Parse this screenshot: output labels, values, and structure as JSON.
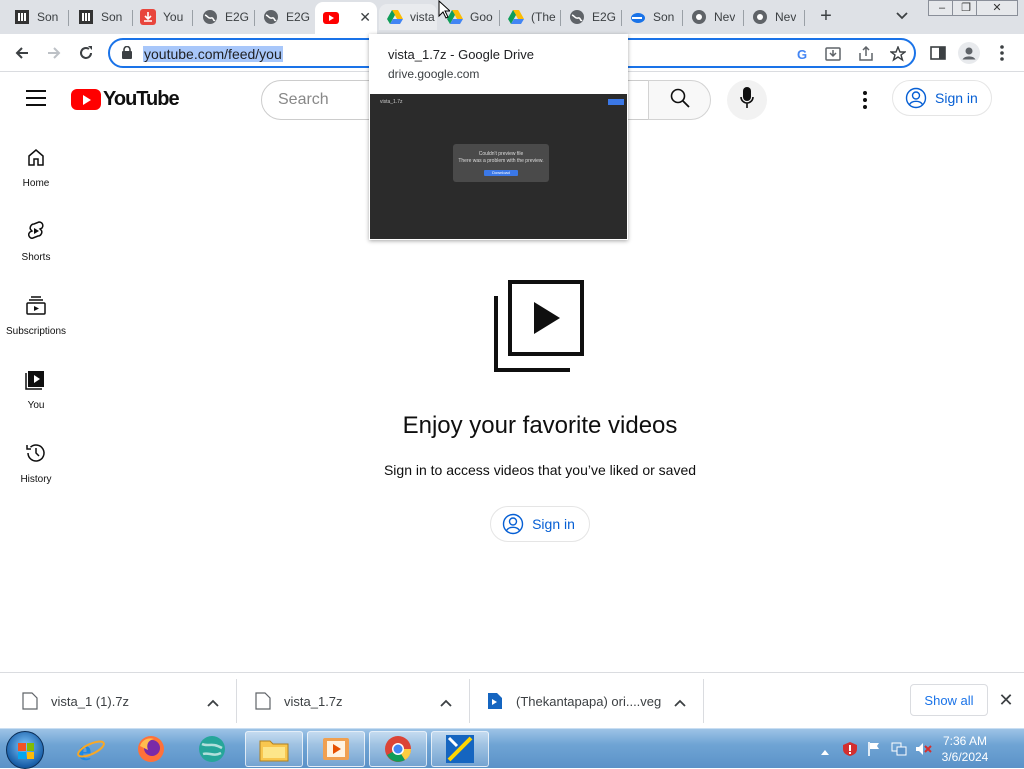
{
  "browser": {
    "tabs": [
      {
        "label": "Son",
        "icon": "archive-icon"
      },
      {
        "label": "Son",
        "icon": "archive-icon"
      },
      {
        "label": "You",
        "icon": "download-icon"
      },
      {
        "label": "E2G",
        "icon": "globe-icon"
      },
      {
        "label": "E2G",
        "icon": "globe-icon"
      },
      {
        "label": "",
        "icon": "youtube-icon"
      },
      {
        "label": "vista",
        "icon": "drive-icon"
      },
      {
        "label": "Goo",
        "icon": "drive-icon"
      },
      {
        "label": "(The",
        "icon": "drive-icon"
      },
      {
        "label": "E2G",
        "icon": "globe-icon"
      },
      {
        "label": "Son",
        "icon": "cloud-icon"
      },
      {
        "label": "Nev",
        "icon": "chrome-icon"
      },
      {
        "label": "Nev",
        "icon": "chrome-icon"
      }
    ],
    "new_tab": "+",
    "url": "youtube.com/feed/you"
  },
  "hover_card": {
    "title": "vista_1.7z - Google Drive",
    "domain": "drive.google.com",
    "thumb_title": "vista_1.7z",
    "thumb_line1": "Couldn't preview file",
    "thumb_line2": "There was a problem with the preview.",
    "thumb_button": "Download"
  },
  "youtube": {
    "logo_text": "YouTube",
    "search_placeholder": "Search",
    "sign_in": "Sign in",
    "guide": [
      {
        "label": "Home",
        "icon": "home-icon"
      },
      {
        "label": "Shorts",
        "icon": "shorts-icon"
      },
      {
        "label": "Subscriptions",
        "icon": "subscriptions-icon"
      },
      {
        "label": "You",
        "icon": "you-icon"
      },
      {
        "label": "History",
        "icon": "history-icon"
      }
    ],
    "empty_title": "Enjoy your favorite videos",
    "empty_subtitle": "Sign in to access videos that you’ve liked or saved",
    "empty_sign_in": "Sign in"
  },
  "downloads": {
    "items": [
      {
        "name": "vista_1 (1).7z"
      },
      {
        "name": "vista_1.7z"
      },
      {
        "name": "(Thekantapapa) ori....veg"
      }
    ],
    "show_all": "Show all",
    "close": "✕"
  },
  "taskbar": {
    "time": "7:36 AM",
    "date": "3/6/2024"
  },
  "colors": {
    "accent": "#1a73e8",
    "youtube_red": "#ff0000",
    "youtube_link": "#065fd4"
  }
}
